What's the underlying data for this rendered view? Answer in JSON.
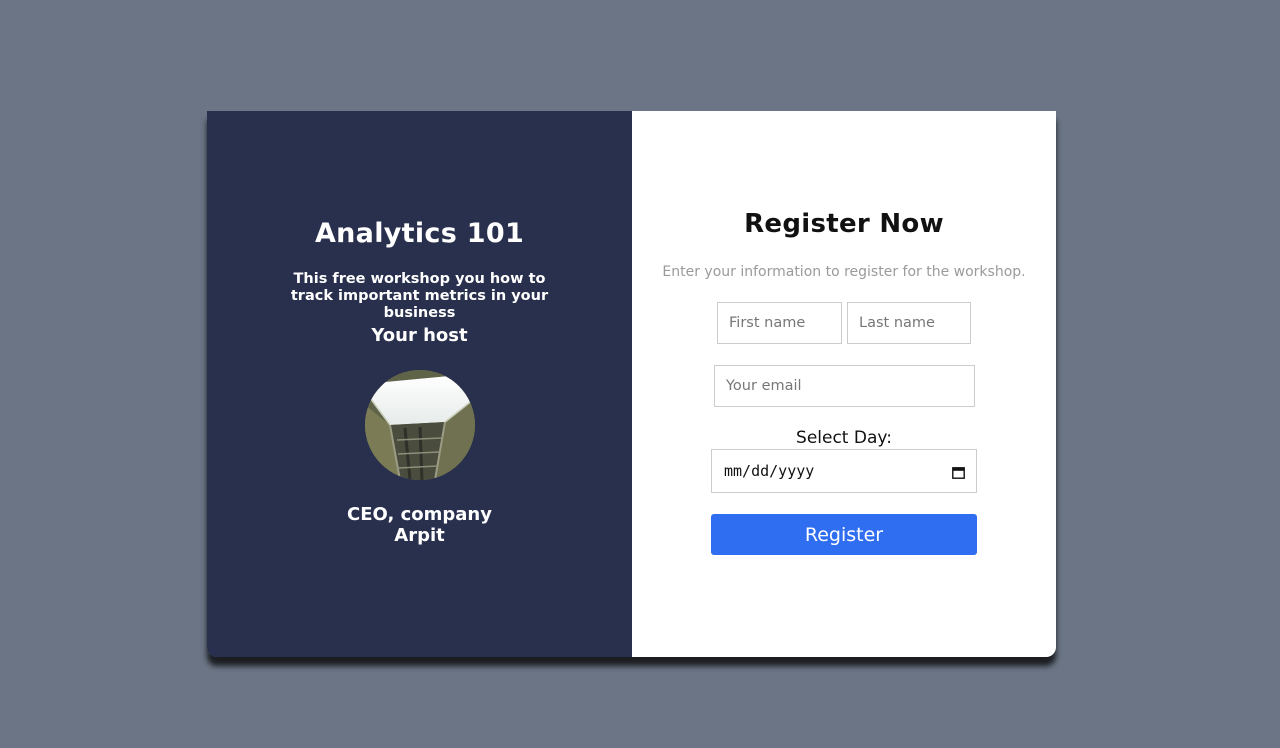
{
  "left_panel": {
    "title": "Analytics 101",
    "description": "This free workshop you how to track important metrics in your business",
    "host_label": "Your host",
    "host_role": "CEO, company",
    "host_name": "Arpit"
  },
  "right_panel": {
    "title": "Register Now",
    "subtitle": "Enter your information to register for the workshop.",
    "first_name_placeholder": "First name",
    "last_name_placeholder": "Last name",
    "email_placeholder": "Your email",
    "day_label": "Select Day:",
    "date_placeholder": "mm/dd/yyyy",
    "register_label": "Register"
  },
  "icons": {
    "date_picker": "calendar-icon",
    "host_photo": "avatar"
  },
  "colors": {
    "background": "#6b7585",
    "left_panel": "#29304d",
    "right_panel": "#ffffff",
    "button": "#2f6ef0"
  }
}
